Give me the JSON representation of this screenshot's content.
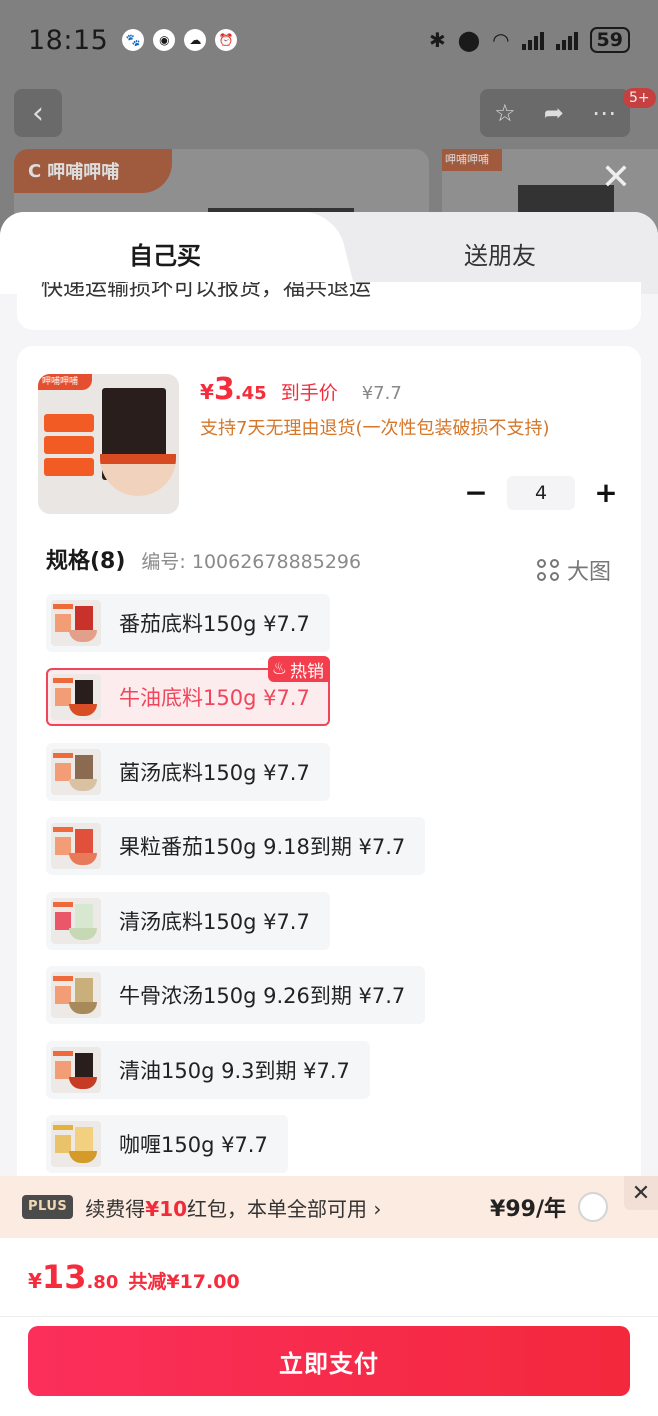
{
  "status_bar": {
    "time": "18:15",
    "battery": "59"
  },
  "background": {
    "badge": "5+",
    "brand": "呷哺呷哺"
  },
  "tabs": {
    "self": "自己买",
    "gift": "送朋友"
  },
  "previous_card_text": "快递运输损坏可以报货，福共退运",
  "product": {
    "price_yen": "¥",
    "price_int": "3",
    "price_dec": ".45",
    "price_tag": "到手价",
    "original_price": "¥7.7",
    "return_note": "支持7天无理由退货(一次性包装破损不支持)",
    "quantity": "4"
  },
  "spec": {
    "title": "规格(8)",
    "sku": "编号: 10062678885296",
    "big_image": "大图",
    "hot_label": "热销",
    "items": [
      {
        "label": "番茄底料150g  ¥7.7"
      },
      {
        "label": "牛油底料150g  ¥7.7"
      },
      {
        "label": "菌汤底料150g  ¥7.7"
      },
      {
        "label": "果粒番茄150g 9.18到期  ¥7.7"
      },
      {
        "label": "清汤底料150g  ¥7.7"
      },
      {
        "label": "牛骨浓汤150g 9.26到期  ¥7.7"
      },
      {
        "label": "清油150g 9.3到期  ¥7.7"
      },
      {
        "label": "咖喱150g  ¥7.7"
      }
    ]
  },
  "plus": {
    "badge": "PLUS",
    "text_before": "续费得",
    "text_red": "¥10",
    "text_after": "红包，本单全部可用 ›",
    "price": "¥99/年"
  },
  "total": {
    "yen": "¥",
    "int": "13",
    "dec": ".80",
    "saved": "共减¥17.00"
  },
  "pay_button": "立即支付",
  "colors": {
    "accent": "#f42c3c",
    "selected_border": "#f0455a",
    "note": "#d5772a"
  }
}
